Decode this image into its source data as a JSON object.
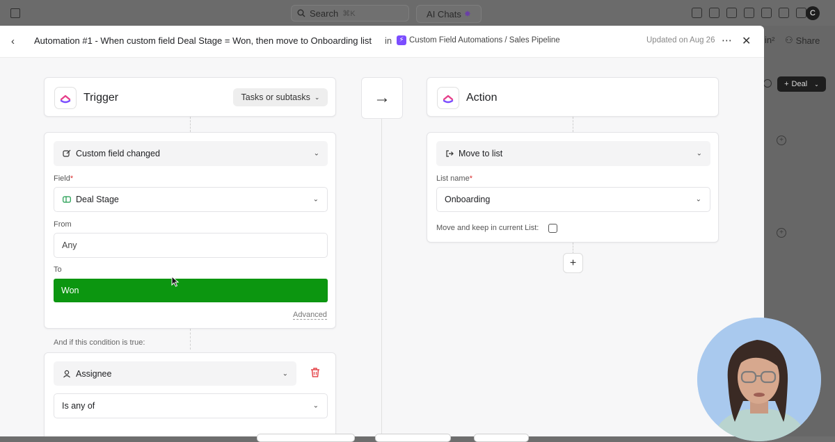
{
  "background_app": {
    "search_label": "Search",
    "search_shortcut": "⌘K",
    "ai_chats_label": "AI Chats",
    "avatar_initial": "C",
    "share_label": "Share",
    "partial_label": "in²",
    "deal_button_label": "Deal"
  },
  "header": {
    "title": "Automation #1 - When custom field Deal Stage = Won, then move to Onboarding list",
    "in_label": "in",
    "breadcrumb": "Custom Field Automations / Sales Pipeline",
    "updated": "Updated on Aug 26"
  },
  "trigger": {
    "title": "Trigger",
    "scope_label": "Tasks or subtasks",
    "event_label": "Custom field changed",
    "field_label": "Field",
    "field_value": "Deal Stage",
    "from_label": "From",
    "from_value": "Any",
    "to_label": "To",
    "to_value": "Won",
    "advanced_label": "Advanced"
  },
  "condition": {
    "intro": "And if this condition is true:",
    "field_value": "Assignee",
    "operator_value": "Is any of"
  },
  "action": {
    "title": "Action",
    "type_label": "Move to list",
    "list_name_label": "List name",
    "list_name_value": "Onboarding",
    "keep_label": "Move and keep in current List:"
  },
  "required_marker": "*",
  "colors": {
    "won_green": "#0c9610",
    "bolt_purple": "#7b4dff",
    "required_red": "#d92d2d",
    "trash_red": "#e5484d"
  },
  "icons": [
    "calendar-icon",
    "search-icon",
    "sparkle-icon",
    "back-icon",
    "bolt-icon",
    "more-icon",
    "close-icon",
    "clickup-logo",
    "chevron-down-icon",
    "edit-field-icon",
    "dropdown-field-icon",
    "arrow-right-icon",
    "move-list-icon",
    "plus-icon",
    "user-icon",
    "trash-icon",
    "gear-icon"
  ]
}
